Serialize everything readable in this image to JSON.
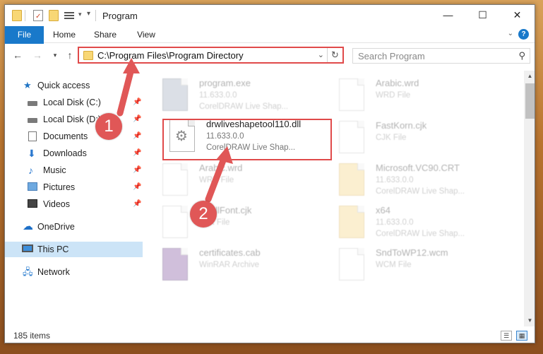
{
  "window": {
    "title": "Program",
    "controls": {
      "minimize": "—",
      "maximize": "☐",
      "close": "✕"
    }
  },
  "ribbon": {
    "tabs": [
      "File",
      "Home",
      "Share",
      "View"
    ],
    "help": "?"
  },
  "address": {
    "path": "C:\\Program Files\\Program Directory",
    "refresh": "↻"
  },
  "search": {
    "placeholder": "Search Program"
  },
  "sidebar": {
    "items": [
      {
        "label": "Quick access",
        "icon": "star-icon"
      },
      {
        "label": "Local Disk (C:)",
        "icon": "disk-icon",
        "pinned": true
      },
      {
        "label": "Local Disk (D:)",
        "icon": "disk-icon",
        "pinned": true
      },
      {
        "label": "Documents",
        "icon": "document-icon",
        "pinned": true
      },
      {
        "label": "Downloads",
        "icon": "download-icon",
        "pinned": true
      },
      {
        "label": "Music",
        "icon": "music-icon",
        "pinned": true
      },
      {
        "label": "Pictures",
        "icon": "pictures-icon",
        "pinned": true
      },
      {
        "label": "Videos",
        "icon": "videos-icon",
        "pinned": true
      },
      {
        "label": "OneDrive",
        "icon": "cloud-icon"
      },
      {
        "label": "This PC",
        "icon": "computer-icon",
        "selected": true
      },
      {
        "label": "Network",
        "icon": "network-icon"
      }
    ]
  },
  "files": [
    {
      "name": "program.exe",
      "line1": "11.633.0.0",
      "line2": "CorelDRAW Live Shap...",
      "icon": "exe-icon"
    },
    {
      "name": "Arabic.wrd",
      "line1": "WRD File",
      "line2": "",
      "icon": "file-icon"
    },
    {
      "name": "drwliveshapetool110.dll",
      "line1": "11.633.0.0",
      "line2": "CorelDRAW Live Shap...",
      "icon": "dll-gear-icon",
      "highlighted": true
    },
    {
      "name": "FastKorn.cjk",
      "line1": "CJK File",
      "line2": "",
      "icon": "file-icon"
    },
    {
      "name": "Arabic.wrd",
      "line1": "WRD File",
      "line2": "",
      "icon": "file-icon"
    },
    {
      "name": "Microsoft.VC90.CRT",
      "line1": "11.633.0.0",
      "line2": "CorelDRAW Live Shap...",
      "icon": "folder-icon"
    },
    {
      "name": "SpellFont.cjk",
      "line1": "CJK File",
      "line2": "",
      "icon": "file-icon"
    },
    {
      "name": "x64",
      "line1": "11.633.0.0",
      "line2": "CorelDRAW Live Shap...",
      "icon": "folder-icon"
    },
    {
      "name": "certificates.cab",
      "line1": "WinRAR Archive",
      "line2": "",
      "icon": "archive-icon"
    },
    {
      "name": "SndToWP12.wcm",
      "line1": "WCM File",
      "line2": "",
      "icon": "file-icon"
    }
  ],
  "status": {
    "count": "185 items"
  },
  "annotations": {
    "marker1": "1",
    "marker2": "2",
    "color": "#e05757"
  }
}
